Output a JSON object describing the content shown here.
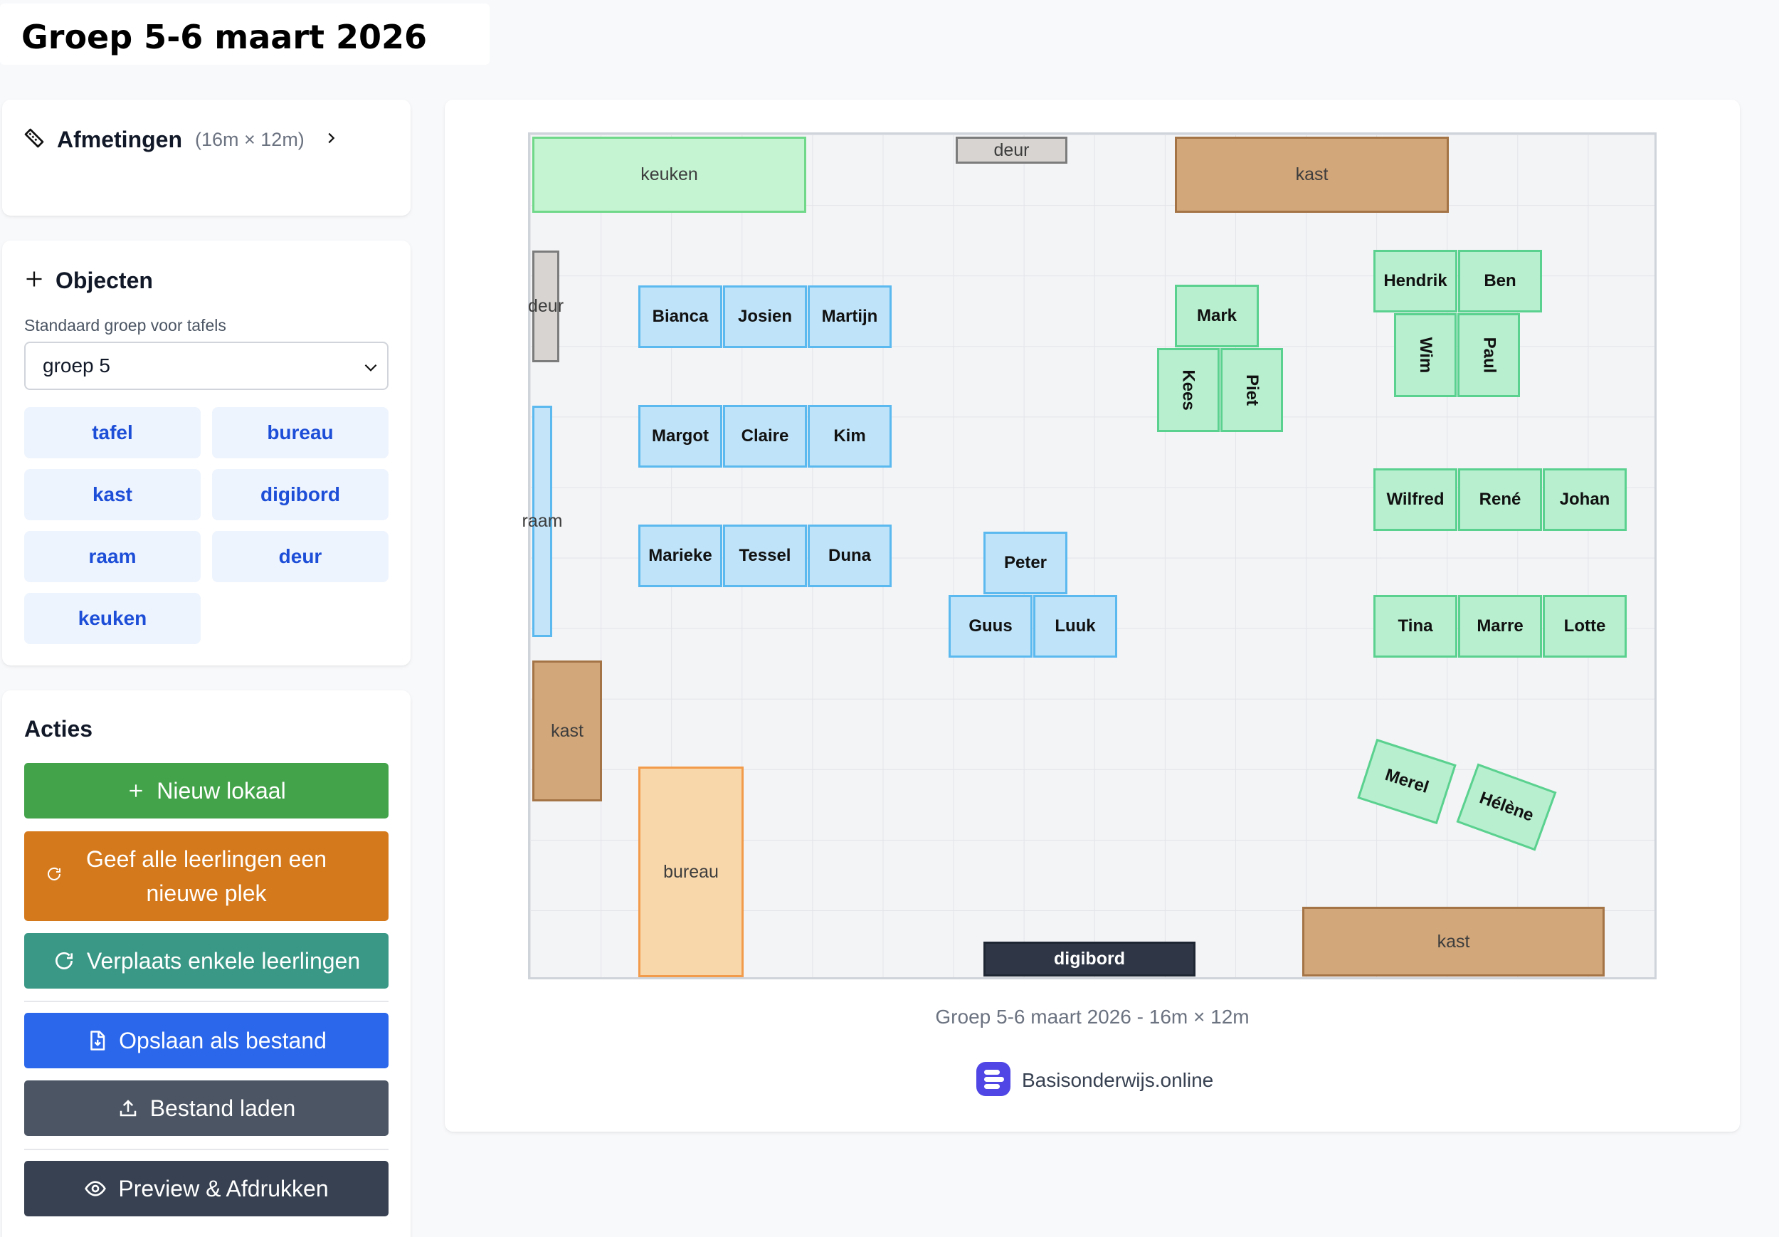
{
  "page_title": "Groep 5-6 maart 2026",
  "dimensions": {
    "label": "Afmetingen",
    "value": "(16m × 12m)"
  },
  "objects": {
    "heading": "Objecten",
    "group_label": "Standaard groep voor tafels",
    "group_selected": "groep 5",
    "buttons": [
      "tafel",
      "bureau",
      "kast",
      "digibord",
      "raam",
      "deur",
      "keuken"
    ]
  },
  "actions": {
    "heading": "Acties",
    "new_room": "Nieuw lokaal",
    "shuffle_line1": "Geef alle leerlingen een",
    "shuffle_line2": "nieuwe plek",
    "move_some": "Verplaats enkele leerlingen",
    "save": "Opslaan als bestand",
    "load": "Bestand laden",
    "preview": "Preview & Afdrukken"
  },
  "room": {
    "keuken": "keuken",
    "deur_top": "deur",
    "deur_left": "deur",
    "kast_top": "kast",
    "kast_left": "kast",
    "kast_bottom": "kast",
    "raam": "raam",
    "bureau": "bureau",
    "digibord": "digibord",
    "students": [
      "Bianca",
      "Josien",
      "Martijn",
      "Margot",
      "Claire",
      "Kim",
      "Marieke",
      "Tessel",
      "Duna",
      "Peter",
      "Guus",
      "Luuk",
      "Mark",
      "Kees",
      "Piet",
      "Hendrik",
      "Ben",
      "Wim",
      "Paul",
      "Wilfred",
      "René",
      "Johan",
      "Tina",
      "Marre",
      "Lotte",
      "Merel",
      "Hélène"
    ]
  },
  "caption": "Groep 5-6 maart 2026 - 16m × 12m",
  "brand": "Basisonderwijs.online",
  "colors": {
    "group5_fill": "#bfe3f8",
    "group6_fill": "#b7efcf",
    "btn_green": "#43a34a",
    "btn_orange": "#d57a1c",
    "btn_teal": "#3a9886",
    "btn_blue": "#2b67eb",
    "btn_gray": "#4b5563",
    "btn_dark": "#374151",
    "brand": "#4f46e5"
  }
}
